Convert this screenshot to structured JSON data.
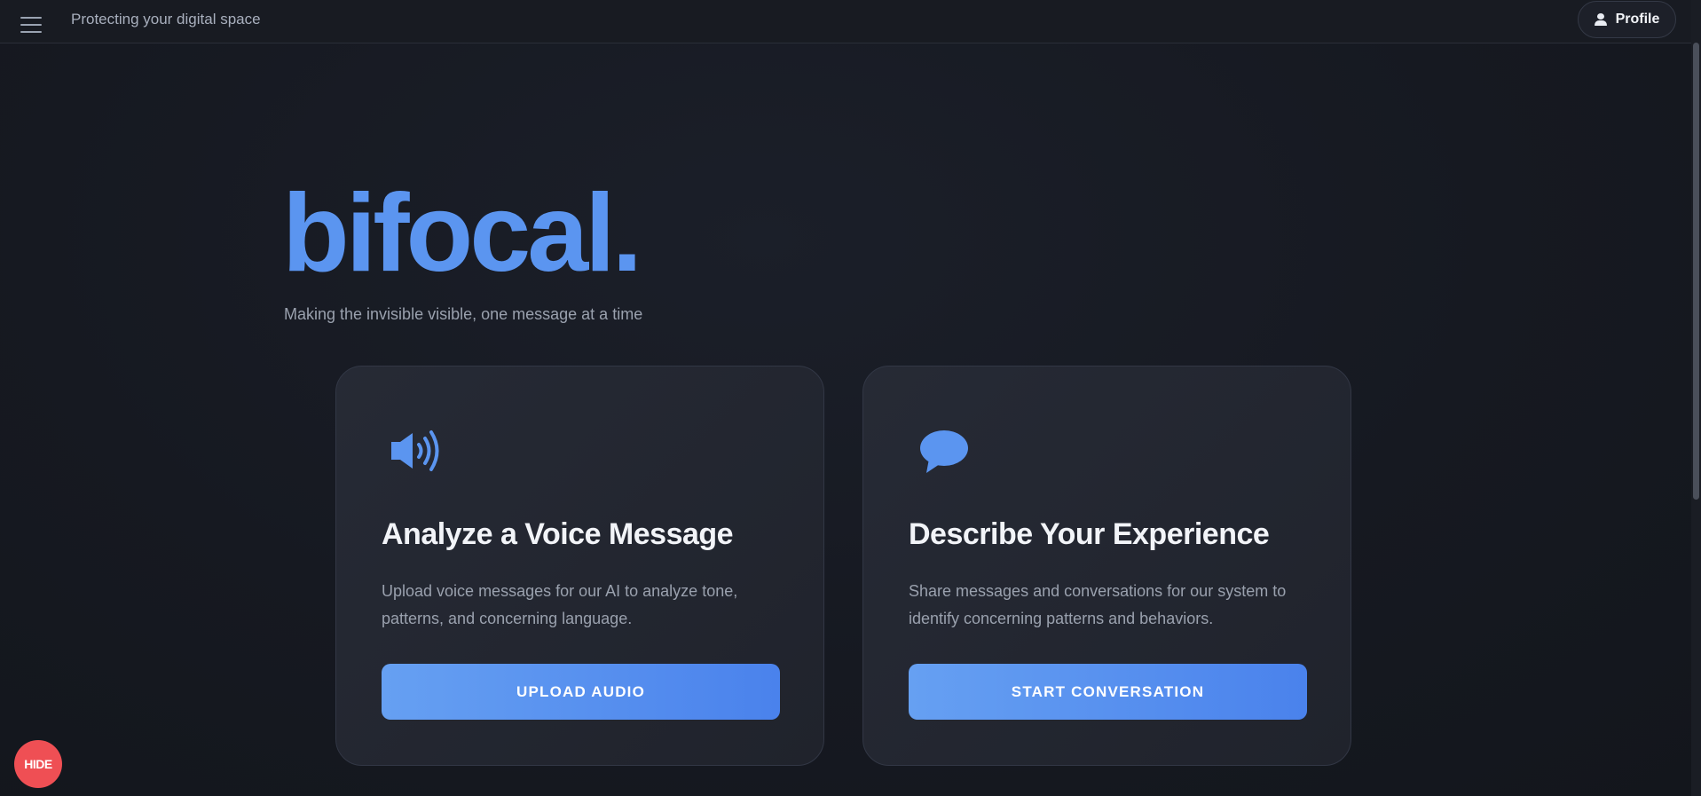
{
  "header": {
    "tagline": "Protecting your digital space",
    "profile_label": "Profile"
  },
  "hero": {
    "brand": "bifocal.",
    "subtitle": "Making the invisible visible, one message at a time"
  },
  "cards": [
    {
      "icon": "speaker-icon",
      "title": "Analyze a Voice Message",
      "description": "Upload voice messages for our AI to analyze tone, patterns, and concerning language.",
      "button_label": "UPLOAD AUDIO"
    },
    {
      "icon": "speech-bubble-icon",
      "title": "Describe Your Experience",
      "description": "Share messages and conversations for our system to identify concerning patterns and behaviors.",
      "button_label": "START CONVERSATION"
    }
  ],
  "hide_button": {
    "label": "HIDE"
  },
  "colors": {
    "accent": "#5b95f0",
    "background": "#15181f",
    "card": "#242833",
    "danger": "#ef4f54"
  }
}
